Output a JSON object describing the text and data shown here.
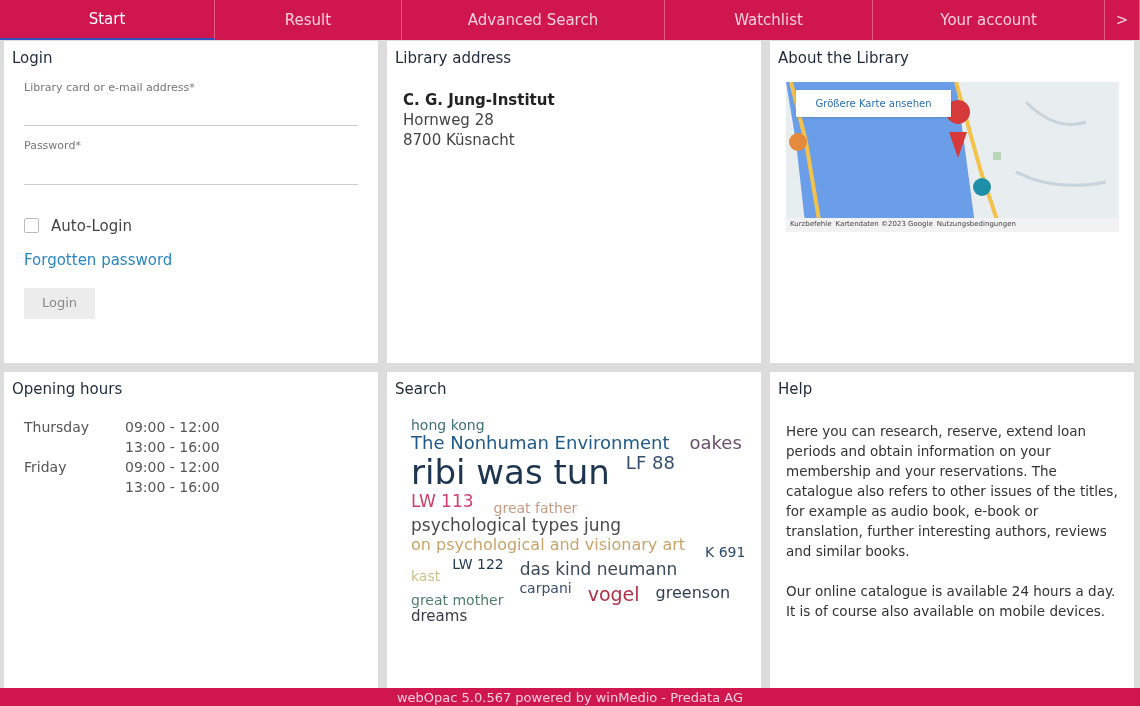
{
  "tabs": [
    {
      "label": "Start",
      "selected": true
    },
    {
      "label": "Result",
      "selected": false
    },
    {
      "label": "Advanced Search",
      "selected": false
    },
    {
      "label": "Watchlist",
      "selected": false
    },
    {
      "label": "Your account",
      "selected": false
    },
    {
      "label": ">",
      "selected": false
    }
  ],
  "login": {
    "title": "Login",
    "fields": [
      {
        "label": "Library card or e-mail address*"
      },
      {
        "label": "Password*"
      }
    ],
    "auto_login": {
      "label": "Auto-Login",
      "checked": false
    },
    "forgot_link": "Forgotten password",
    "button": {
      "label": "Login",
      "disabled": true
    }
  },
  "address": {
    "title": "Library address",
    "name": "C. G. Jung-Institut",
    "lines": [
      "Hornweg 28",
      "8700 Küsnacht"
    ]
  },
  "about": {
    "title": "About the Library",
    "map": {
      "kind": "picture",
      "button": "Größere Karte ansehen",
      "attribution": [
        "Kurzbefehle",
        "Kartendaten ©2023 Google",
        "Nutzungsbedingungen"
      ]
    }
  },
  "hours": {
    "title": "Opening hours",
    "days": [
      {
        "day": "Thursday",
        "times": [
          "09:00 - 12:00",
          "13:00 - 16:00"
        ]
      },
      {
        "day": "Friday",
        "times": [
          "09:00 - 12:00",
          "13:00 - 16:00"
        ]
      }
    ]
  },
  "search": {
    "title": "Search",
    "rows": [
      [
        {
          "text": "hong kong",
          "color": "#3f6e78"
        }
      ],
      [
        {
          "text": "The Nonhuman Environment",
          "color": "#1f5a8a"
        },
        {
          "text": "oakes",
          "color": "#6a4e6e"
        }
      ],
      [
        {
          "text": "ribi was tun",
          "color": "#1d3550"
        },
        {
          "text": "LF 88",
          "color": "#3a4f6e"
        }
      ],
      [
        {
          "text": "LW 113",
          "color": "#d0406e"
        },
        {
          "text": "great father",
          "color": "#c99a82"
        }
      ],
      [
        {
          "text": "psychological types jung",
          "color": "#4a4a4a"
        }
      ],
      [
        {
          "text": "on psychological and visionary art",
          "color": "#c9a36a"
        },
        {
          "text": "K 691",
          "color": "#2b4a6a"
        }
      ],
      [
        {
          "text": "kast",
          "color": "#c9c28a"
        },
        {
          "text": "LW 122",
          "color": "#233a55"
        },
        {
          "text": "das kind neumann",
          "color": "#3d4a5c"
        }
      ],
      [
        {
          "text": "great mother",
          "color": "#4f7e6a"
        },
        {
          "text": "carpani",
          "color": "#3a4f6e"
        },
        {
          "text": "vogel",
          "color": "#b0304a"
        },
        {
          "text": "greenson",
          "color": "#2f3f55"
        }
      ],
      [
        {
          "text": "dreams",
          "color": "#3a3a4a"
        }
      ]
    ]
  },
  "help": {
    "title": "Help",
    "paragraphs": [
      "Here you can research, reserve, extend loan periods and obtain information on your membership and your reservations. The catalogue also refers to other issues of the titles, for example as audio book, e-book or translation, further interesting authors, reviews and similar books.",
      "Our online catalogue is available 24 hours a day. It is of course also available on mobile devices."
    ]
  },
  "footer": "webOpac 5.0.567 powered by winMedio - Predata AG"
}
